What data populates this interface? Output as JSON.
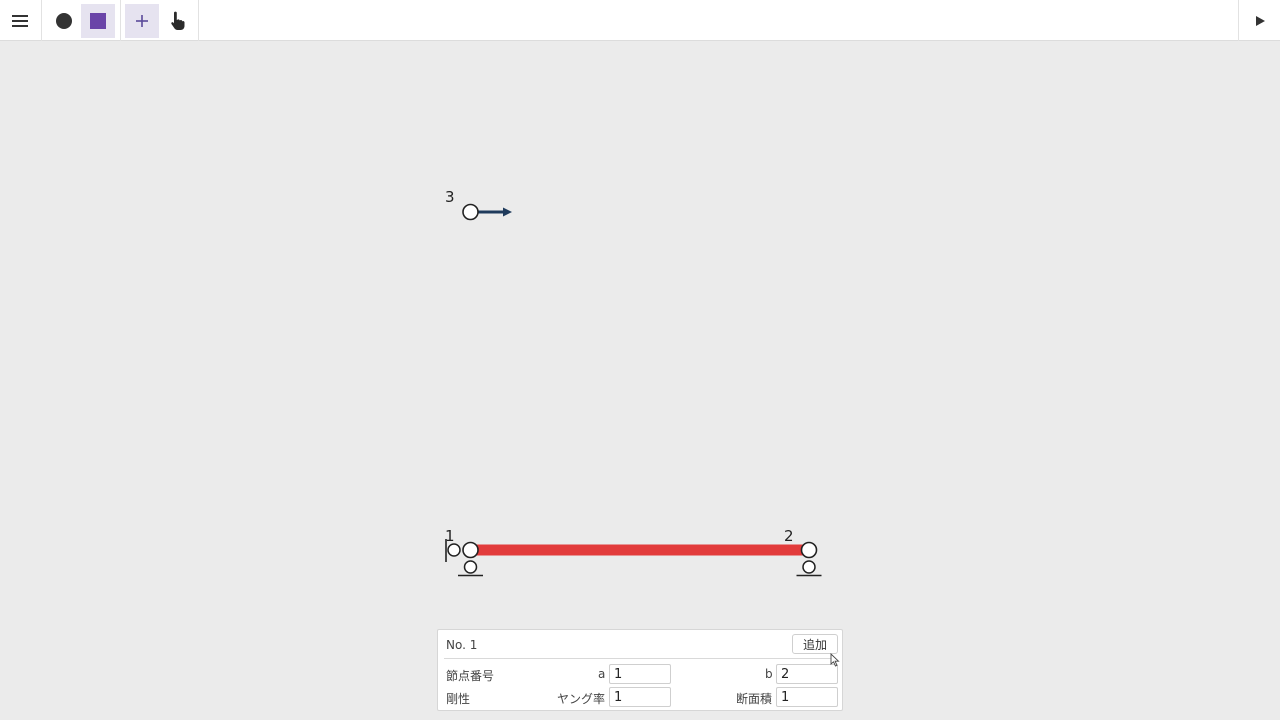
{
  "toolbar": {
    "menu_icon": "hamburger-menu-icon",
    "tools": [
      {
        "name": "node-tool",
        "icon": "circle-icon"
      },
      {
        "name": "member-tool",
        "icon": "square-icon",
        "color": "#6a44a8"
      },
      {
        "name": "add-tool",
        "icon": "plus-icon",
        "label": "+"
      },
      {
        "name": "pan-tool",
        "icon": "hand-pointer-icon"
      }
    ],
    "run_icon": "play-icon"
  },
  "model": {
    "member_color": "#e23b3b",
    "load_color": "#1f3b5c",
    "nodes": [
      {
        "id": "1",
        "label": "1"
      },
      {
        "id": "2",
        "label": "2"
      },
      {
        "id": "3",
        "label": "3"
      }
    ]
  },
  "panel": {
    "title": "No. 1",
    "add_label": "追加",
    "row1": {
      "heading": "節点番号",
      "a_label": "a",
      "a_value": "1",
      "b_label": "b",
      "b_value": "2"
    },
    "row2": {
      "heading": "剛性",
      "young_label": "ヤング率",
      "young_value": "1",
      "area_label": "断面積",
      "area_value": "1"
    }
  }
}
